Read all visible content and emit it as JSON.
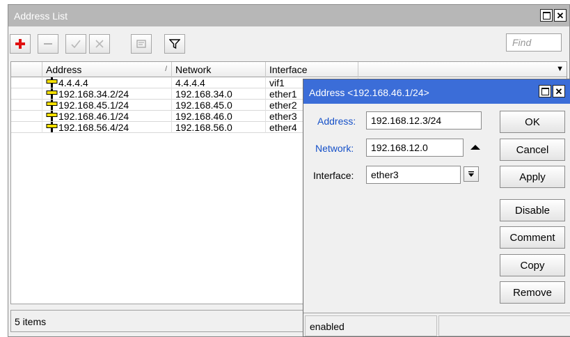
{
  "main_window": {
    "title": "Address List",
    "find_placeholder": "Find",
    "columns": [
      "Address",
      "Network",
      "Interface"
    ],
    "rows": [
      {
        "address": "4.4.4.4",
        "network": "4.4.4.4",
        "interface": "vif1"
      },
      {
        "address": "192.168.34.2/24",
        "network": "192.168.34.0",
        "interface": "ether1"
      },
      {
        "address": "192.168.45.1/24",
        "network": "192.168.45.0",
        "interface": "ether2"
      },
      {
        "address": "192.168.46.1/24",
        "network": "192.168.46.0",
        "interface": "ether3"
      },
      {
        "address": "192.168.56.4/24",
        "network": "192.168.56.0",
        "interface": "ether4"
      }
    ],
    "status": "5 items"
  },
  "dialog": {
    "title": "Address <192.168.46.1/24>",
    "address_label": "Address:",
    "address_value": "192.168.12.3/24",
    "network_label": "Network:",
    "network_value": "192.168.12.0",
    "interface_label": "Interface:",
    "interface_value": "ether3",
    "buttons": {
      "ok": "OK",
      "cancel": "Cancel",
      "apply": "Apply",
      "disable": "Disable",
      "comment": "Comment",
      "copy": "Copy",
      "remove": "Remove"
    },
    "status": "enabled"
  },
  "colors": {
    "dialog_title_bg": "#3b6dd8",
    "label_blue": "#1550c8",
    "add_red": "#e01010",
    "address_icon_yellow": "#f5e000"
  }
}
